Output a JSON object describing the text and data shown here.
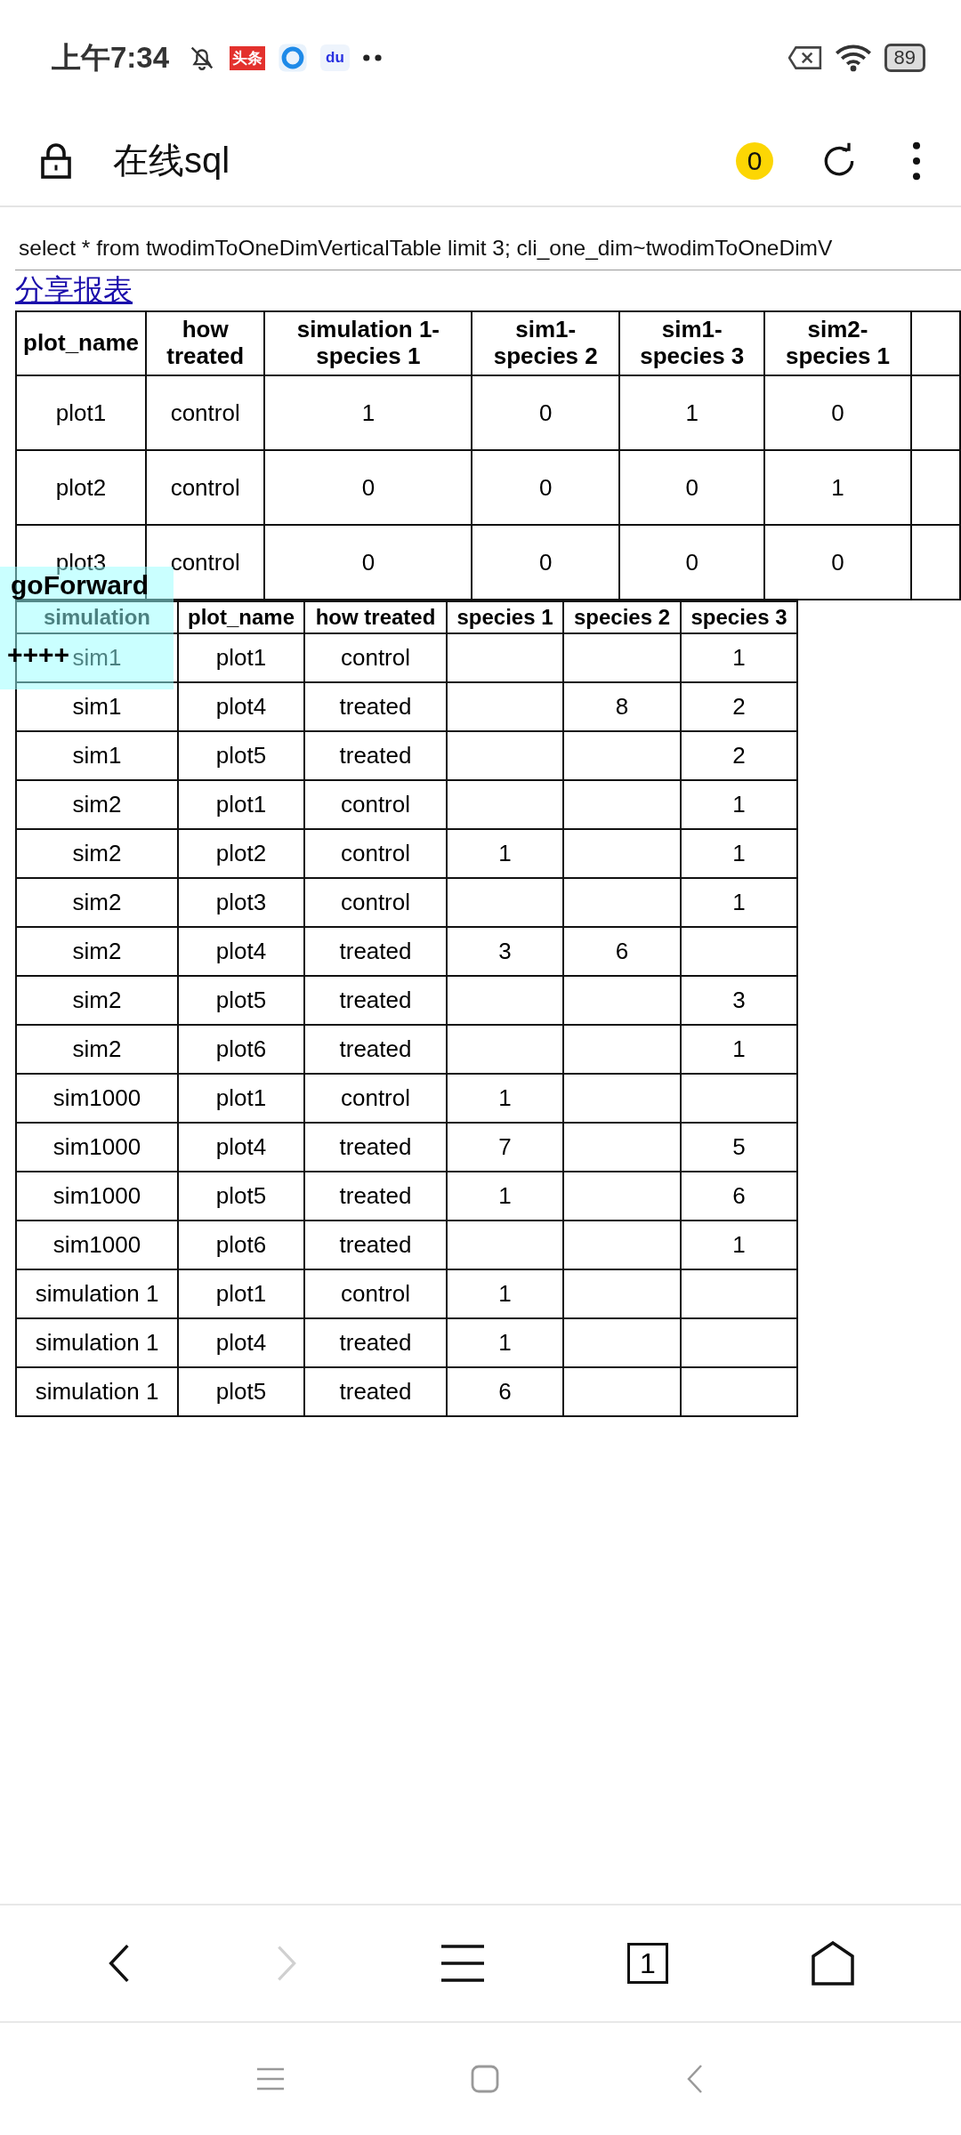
{
  "status_bar": {
    "time": "上午7:34",
    "app_badges": [
      "头条",
      "du"
    ],
    "battery": "89"
  },
  "toolbar": {
    "title": "在线sql",
    "badge": "0"
  },
  "query": "select * from twodimToOneDimVerticalTable limit 3; cli_one_dim~twodimToOneDimV",
  "share_link": "分享报表",
  "table_1": {
    "columns": [
      "plot_name",
      "how treated",
      "simulation 1-species 1",
      "sim1-species 2",
      "sim1-species 3",
      "sim2-species 1"
    ],
    "rows": [
      [
        "plot1",
        "control",
        "1",
        "0",
        "1",
        "0"
      ],
      [
        "plot2",
        "control",
        "0",
        "0",
        "0",
        "1"
      ],
      [
        "plot3",
        "control",
        "0",
        "0",
        "0",
        "0"
      ]
    ]
  },
  "overlay": {
    "title": "goForward",
    "marks": "++++"
  },
  "table_2": {
    "columns": [
      "simulation",
      "plot_name",
      "how treated",
      "species 1",
      "species 2",
      "species 3"
    ],
    "rows": [
      [
        "sim1",
        "plot1",
        "control",
        null,
        null,
        "1"
      ],
      [
        "sim1",
        "plot4",
        "treated",
        null,
        "8",
        "2"
      ],
      [
        "sim1",
        "plot5",
        "treated",
        null,
        null,
        "2"
      ],
      [
        "sim2",
        "plot1",
        "control",
        null,
        null,
        "1"
      ],
      [
        "sim2",
        "plot2",
        "control",
        "1",
        null,
        "1"
      ],
      [
        "sim2",
        "plot3",
        "control",
        null,
        null,
        "1"
      ],
      [
        "sim2",
        "plot4",
        "treated",
        "3",
        "6",
        null
      ],
      [
        "sim2",
        "plot5",
        "treated",
        null,
        null,
        "3"
      ],
      [
        "sim2",
        "plot6",
        "treated",
        null,
        null,
        "1"
      ],
      [
        "sim1000",
        "plot1",
        "control",
        "1",
        null,
        null
      ],
      [
        "sim1000",
        "plot4",
        "treated",
        "7",
        null,
        "5"
      ],
      [
        "sim1000",
        "plot5",
        "treated",
        "1",
        null,
        "6"
      ],
      [
        "sim1000",
        "plot6",
        "treated",
        null,
        null,
        "1"
      ],
      [
        "simulation 1",
        "plot1",
        "control",
        "1",
        null,
        null
      ],
      [
        "simulation 1",
        "plot4",
        "treated",
        "1",
        null,
        null
      ],
      [
        "simulation 1",
        "plot5",
        "treated",
        "6",
        null,
        null
      ]
    ]
  },
  "bottom_nav": {
    "back_disabled": false,
    "forward_disabled": true,
    "tab_count": "1"
  }
}
